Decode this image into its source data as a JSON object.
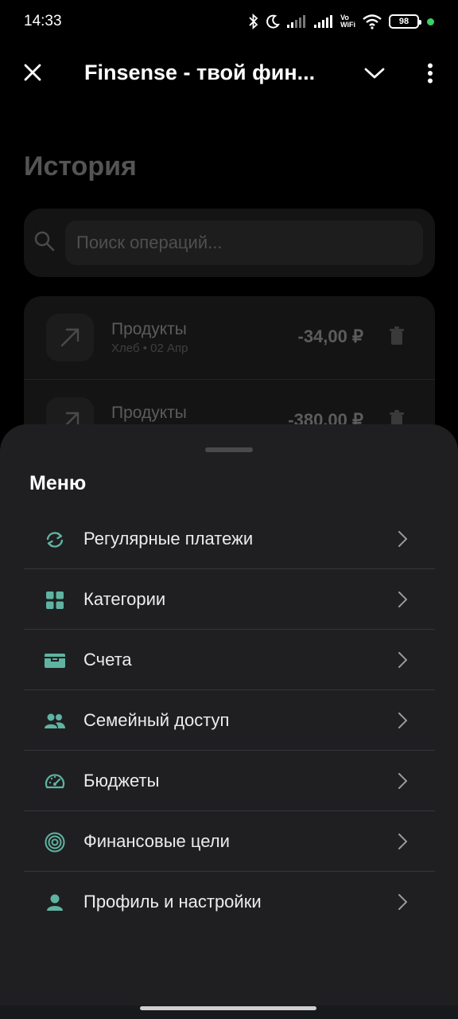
{
  "status_bar": {
    "time": "14:33",
    "network_label_top": "Vo",
    "network_label_bottom": "WiFi",
    "battery": "98"
  },
  "app_bar": {
    "title": "Finsense - твой фин..."
  },
  "history": {
    "heading": "История",
    "search": {
      "placeholder": "Поиск операций..."
    },
    "operations": [
      {
        "title": "Продукты",
        "subtitle": "Хлеб • 02 Апр",
        "amount": "-34,00 ₽"
      },
      {
        "title": "Продукты",
        "subtitle": "",
        "amount": "-380,00 ₽"
      }
    ]
  },
  "menu": {
    "title": "Меню",
    "items": [
      {
        "label": "Регулярные платежи",
        "icon": "recurring-icon"
      },
      {
        "label": "Категории",
        "icon": "categories-icon"
      },
      {
        "label": "Счета",
        "icon": "wallet-icon"
      },
      {
        "label": "Семейный доступ",
        "icon": "family-icon"
      },
      {
        "label": "Бюджеты",
        "icon": "speedometer-icon"
      },
      {
        "label": "Финансовые цели",
        "icon": "target-icon"
      },
      {
        "label": "Профиль и настройки",
        "icon": "person-icon"
      }
    ]
  },
  "colors": {
    "accent": "#5fb3a1",
    "sheet_bg": "#1f1f21",
    "page_bg": "#000000"
  }
}
